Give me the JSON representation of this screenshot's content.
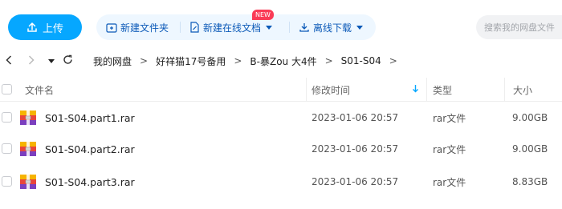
{
  "toolbar": {
    "upload_label": "上传",
    "new_folder_label": "新建文件夹",
    "new_online_doc_label": "新建在线文档",
    "new_badge": "NEW",
    "offline_download_label": "离线下载",
    "search_placeholder": "搜索我的网盘文件"
  },
  "breadcrumb": [
    "我的网盘",
    "好祥猫17号备用",
    "B-暴Zou 大4件",
    "S01-S04"
  ],
  "table": {
    "columns": {
      "name": "文件名",
      "modified": "修改时间",
      "type": "类型",
      "size": "大小"
    },
    "rows": [
      {
        "name": "S01-S04.part1.rar",
        "modified": "2023-01-06 20:57",
        "type": "rar文件",
        "size": "9.00GB"
      },
      {
        "name": "S01-S04.part2.rar",
        "modified": "2023-01-06 20:57",
        "type": "rar文件",
        "size": "9.00GB"
      },
      {
        "name": "S01-S04.part3.rar",
        "modified": "2023-01-06 20:57",
        "type": "rar文件",
        "size": "8.83GB"
      }
    ]
  },
  "icons": {
    "upload": "upload-icon",
    "new_folder": "folder-plus-icon",
    "new_doc": "doc-edit-icon",
    "offline_download": "download-icon",
    "back": "chevron-left-icon",
    "forward": "chevron-right-icon",
    "history": "caret-down-icon",
    "refresh": "refresh-icon",
    "sort": "sort-down-icon",
    "file": "rar-archive-icon"
  },
  "colors": {
    "accent": "#06a7ff",
    "action_text": "#0c5ab8",
    "badge": "#fa3b56"
  }
}
